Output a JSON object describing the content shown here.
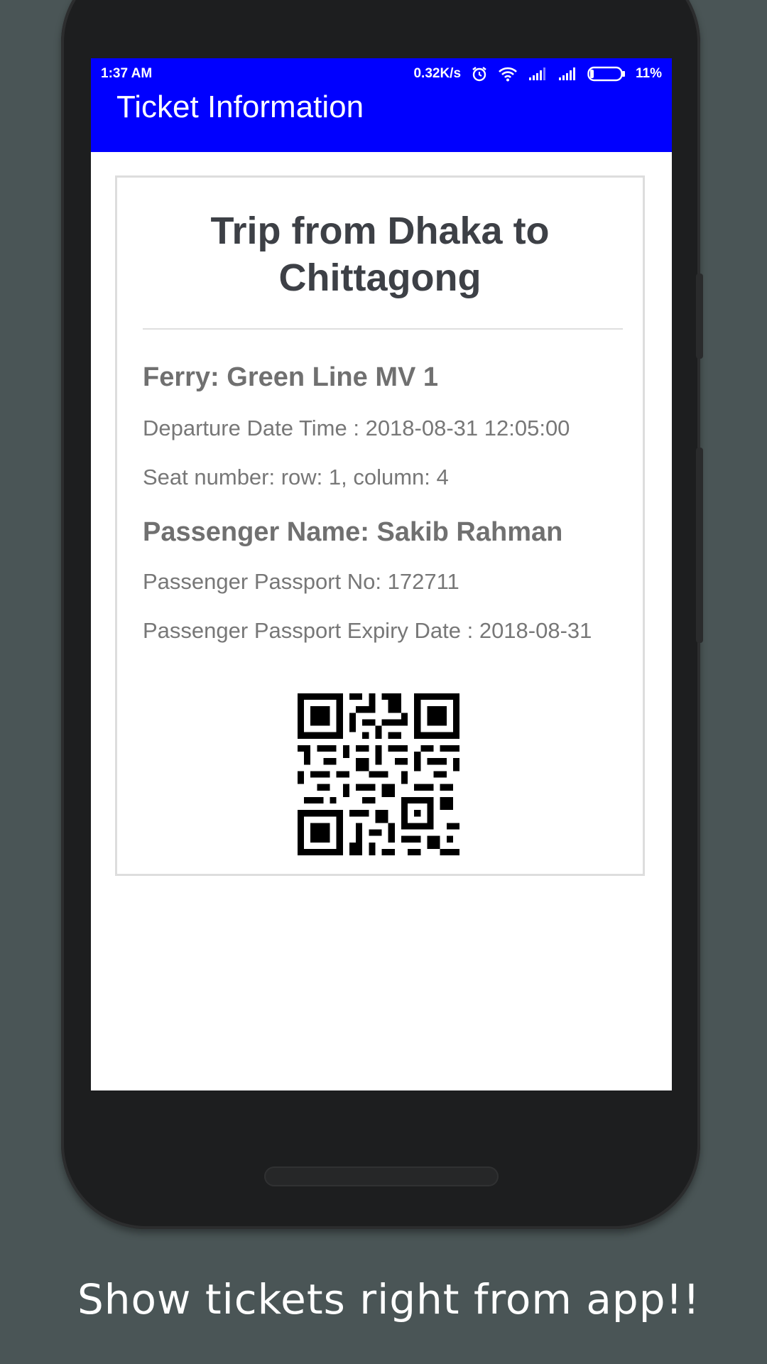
{
  "status_bar": {
    "time": "1:37 AM",
    "speed": "0.32K/s",
    "battery": "11%",
    "icons": [
      "alarm-icon",
      "wifi-icon",
      "signal-icon",
      "signal-icon",
      "battery-icon"
    ]
  },
  "appbar": {
    "title": "Ticket Information",
    "color": "#0000ff"
  },
  "ticket": {
    "heading_line1": "Trip from Dhaka to",
    "heading_line2": "Chittagong",
    "ferry": "Ferry: Green Line MV 1",
    "departure": "Departure Date Time : 2018-08-31 12:05:00",
    "seat": "Seat number: row: 1, column: 4",
    "passenger": "Passenger Name: Sakib Rahman",
    "passport_no": "Passenger Passport No: 172711",
    "passport_expiry": "Passenger Passport Expiry Date : 2018-08-31",
    "qr_icon": "qr-code"
  },
  "caption": "Show tickets right from app!!"
}
